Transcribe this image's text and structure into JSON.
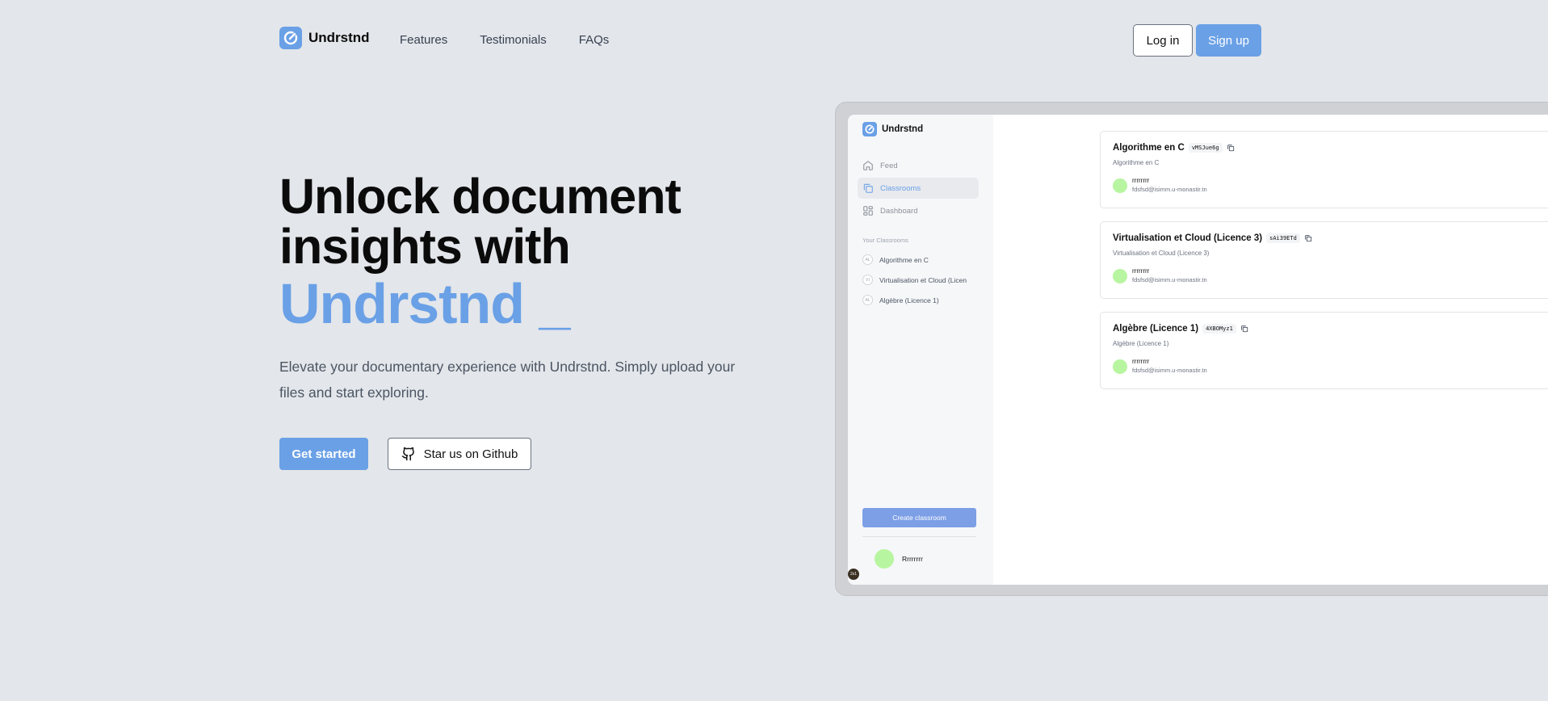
{
  "nav": {
    "brand": "Undrstnd",
    "links": [
      "Features",
      "Testimonials",
      "FAQs"
    ],
    "login": "Log in",
    "signup": "Sign up"
  },
  "hero": {
    "title_line1": "Unlock document",
    "title_line2": "insights with",
    "title_accent": "Undrstnd _",
    "subtitle": "Elevate your documentary experience with Undrstnd. Simply upload your files and start exploring.",
    "cta_primary": "Get started",
    "cta_secondary": "Star us on Github"
  },
  "app": {
    "brand": "Undrstnd",
    "nav": [
      {
        "label": "Feed",
        "icon": "home-icon"
      },
      {
        "label": "Classrooms",
        "icon": "copy-icon"
      },
      {
        "label": "Dashboard",
        "icon": "grid-icon"
      }
    ],
    "section_label": "Your Classrooms",
    "classrooms": [
      {
        "badge": "AL",
        "name": "Algorithme en C"
      },
      {
        "badge": "VI",
        "name": "Virtualisation et Cloud (Licen"
      },
      {
        "badge": "AL",
        "name": "Algèbre (Licence 1)"
      }
    ],
    "create_button": "Create classroom",
    "user_name": "Rrrrrrrr",
    "debug_badge": "2x1",
    "cards": [
      {
        "title": "Algorithme en C",
        "code": "vMSJue6g",
        "subtitle": "Algorithme en C",
        "owner": "rrrrrrrr",
        "email": "fdsfsd@isimm.u-monastir.tn"
      },
      {
        "title": "Virtualisation et Cloud (Licence 3)",
        "code": "sAi39ETd",
        "subtitle": "Virtualisation et Cloud (Licence 3)",
        "owner": "rrrrrrrr",
        "email": "fdsfsd@isimm.u-monastir.tn"
      },
      {
        "title": "Algèbre (Licence 1)",
        "code": "4XBOMyz1",
        "subtitle": "Algèbre (Licence 1)",
        "owner": "rrrrrrrr",
        "email": "fdsfsd@isimm.u-monastir.tn"
      }
    ]
  },
  "colors": {
    "accent": "#6aa0e6",
    "background": "#e3e6ea",
    "avatar": "#b8f5a0",
    "create_button": "#7c9fe6"
  }
}
